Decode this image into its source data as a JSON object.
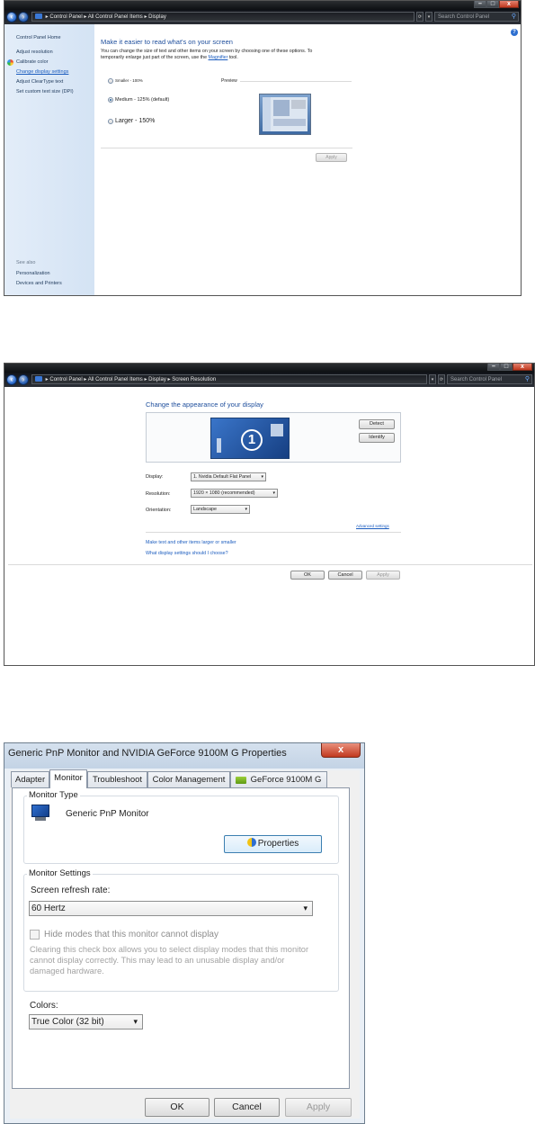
{
  "win1": {
    "address": [
      "Control Panel",
      "All Control Panel Items",
      "Display"
    ],
    "search_placeholder": "Search Control Panel",
    "sidebar": {
      "home": "Control Panel Home",
      "items": [
        "Adjust resolution",
        "Calibrate color",
        "Change display settings",
        "Adjust ClearType text",
        "Set custom text size (DPI)"
      ],
      "see_also": "See also",
      "see_also_items": [
        "Personalization",
        "Devices and Printers"
      ]
    },
    "heading": "Make it easier to read what's on your screen",
    "desc_line1": "You can change the size of text and other items on your screen by choosing one of these options. To",
    "desc_line2_pre": "temporarily enlarge just part of the screen, use the ",
    "desc_link": "Magnifier",
    "desc_line2_post": " tool.",
    "options": [
      {
        "label": "Smaller - 100%",
        "selected": false
      },
      {
        "label": "Medium - 125% (default)",
        "selected": true
      },
      {
        "label": "Larger - 150%",
        "selected": false
      }
    ],
    "preview_label": "Preview",
    "apply": "Apply"
  },
  "win2": {
    "address": [
      "Control Panel",
      "All Control Panel Items",
      "Display",
      "Screen Resolution"
    ],
    "search_placeholder": "Search Control Panel",
    "heading": "Change the appearance of your display",
    "monitor_number": "1",
    "detect": "Detect",
    "identify": "Identify",
    "display_label": "Display:",
    "display_value": "1. Nvidia Default Flat Panel",
    "resolution_label": "Resolution:",
    "resolution_value": "1920 × 1080 (recommended)",
    "orientation_label": "Orientation:",
    "orientation_value": "Landscape",
    "advanced": "Advanced settings",
    "link1": "Make text and other items larger or smaller",
    "link2": "What display settings should I choose?",
    "ok": "OK",
    "cancel": "Cancel",
    "apply": "Apply"
  },
  "dialog": {
    "title": "Generic PnP Monitor and NVIDIA GeForce 9100M G   Properties",
    "tabs": [
      "Adapter",
      "Monitor",
      "Troubleshoot",
      "Color Management",
      "GeForce 9100M G"
    ],
    "selected_tab": "Monitor",
    "monitor_type_label": "Monitor Type",
    "monitor_name": "Generic PnP Monitor",
    "properties": "Properties",
    "settings_label": "Monitor Settings",
    "refresh_label": "Screen refresh rate:",
    "refresh_value": "60 Hertz",
    "hide_modes": "Hide modes that this monitor cannot display",
    "hide_desc": [
      "Clearing this check box allows you to select display modes that this monitor",
      "cannot display correctly. This may lead to an unusable display and/or",
      "damaged hardware."
    ],
    "colors_label": "Colors:",
    "colors_value": "True Color (32 bit)",
    "ok": "OK",
    "cancel": "Cancel",
    "apply": "Apply"
  }
}
